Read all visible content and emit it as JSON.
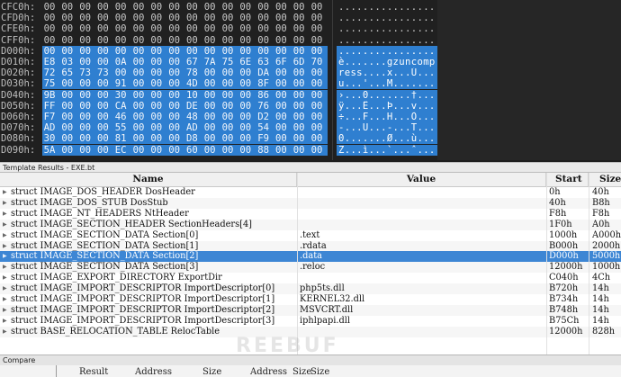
{
  "hex": {
    "rows": [
      {
        "addr": "CFC0h:",
        "bytes": [
          "00",
          "00",
          "00",
          "00",
          "00",
          "00",
          "00",
          "00",
          "00",
          "00",
          "00",
          "00",
          "00",
          "00",
          "00",
          "00"
        ],
        "ascii": "................",
        "selected": false
      },
      {
        "addr": "CFD0h:",
        "bytes": [
          "00",
          "00",
          "00",
          "00",
          "00",
          "00",
          "00",
          "00",
          "00",
          "00",
          "00",
          "00",
          "00",
          "00",
          "00",
          "00"
        ],
        "ascii": "................",
        "selected": false
      },
      {
        "addr": "CFE0h:",
        "bytes": [
          "00",
          "00",
          "00",
          "00",
          "00",
          "00",
          "00",
          "00",
          "00",
          "00",
          "00",
          "00",
          "00",
          "00",
          "00",
          "00"
        ],
        "ascii": "................",
        "selected": false
      },
      {
        "addr": "CFF0h:",
        "bytes": [
          "00",
          "00",
          "00",
          "00",
          "00",
          "00",
          "00",
          "00",
          "00",
          "00",
          "00",
          "00",
          "00",
          "00",
          "00",
          "00"
        ],
        "ascii": "................",
        "selected": false
      },
      {
        "addr": "D000h:",
        "bytes": [
          "00",
          "00",
          "00",
          "00",
          "00",
          "00",
          "00",
          "00",
          "00",
          "00",
          "00",
          "00",
          "00",
          "00",
          "00",
          "00"
        ],
        "ascii": "................",
        "selected": true
      },
      {
        "addr": "D010h:",
        "bytes": [
          "E8",
          "03",
          "00",
          "00",
          "0A",
          "00",
          "00",
          "00",
          "67",
          "7A",
          "75",
          "6E",
          "63",
          "6F",
          "6D",
          "70"
        ],
        "ascii": "è.......gzuncomp",
        "selected": true
      },
      {
        "addr": "D020h:",
        "bytes": [
          "72",
          "65",
          "73",
          "73",
          "00",
          "00",
          "00",
          "00",
          "78",
          "00",
          "00",
          "00",
          "DA",
          "00",
          "00",
          "00"
        ],
        "ascii": "ress....x...Ú...",
        "selected": true
      },
      {
        "addr": "D030h:",
        "bytes": [
          "75",
          "00",
          "00",
          "00",
          "91",
          "00",
          "00",
          "00",
          "4D",
          "00",
          "00",
          "00",
          "8F",
          "00",
          "00",
          "00"
        ],
        "ascii": "u...'...M.......",
        "selected": true
      },
      {
        "addr": "D040h:",
        "bytes": [
          "9B",
          "00",
          "00",
          "00",
          "30",
          "00",
          "00",
          "00",
          "10",
          "00",
          "00",
          "00",
          "86",
          "00",
          "00",
          "00"
        ],
        "ascii": "›...0.......†...",
        "selected": true
      },
      {
        "addr": "D050h:",
        "bytes": [
          "FF",
          "00",
          "00",
          "00",
          "CA",
          "00",
          "00",
          "00",
          "DE",
          "00",
          "00",
          "00",
          "76",
          "00",
          "00",
          "00"
        ],
        "ascii": "ÿ...Ê...Þ...v...",
        "selected": true
      },
      {
        "addr": "D060h:",
        "bytes": [
          "F7",
          "00",
          "00",
          "00",
          "46",
          "00",
          "00",
          "00",
          "48",
          "00",
          "00",
          "00",
          "D2",
          "00",
          "00",
          "00"
        ],
        "ascii": "÷...F...H...Ò...",
        "selected": true
      },
      {
        "addr": "D070h:",
        "bytes": [
          "AD",
          "00",
          "00",
          "00",
          "55",
          "00",
          "00",
          "00",
          "AD",
          "00",
          "00",
          "00",
          "54",
          "00",
          "00",
          "00"
        ],
        "ascii": "-...U...-...T...",
        "selected": true
      },
      {
        "addr": "D080h:",
        "bytes": [
          "30",
          "00",
          "00",
          "00",
          "81",
          "00",
          "00",
          "00",
          "D8",
          "00",
          "00",
          "00",
          "F9",
          "00",
          "00",
          "00"
        ],
        "ascii": "0.......Ø...ù...",
        "selected": true
      },
      {
        "addr": "D090h:",
        "bytes": [
          "5A",
          "00",
          "00",
          "00",
          "EC",
          "00",
          "00",
          "00",
          "60",
          "00",
          "00",
          "00",
          "88",
          "00",
          "00",
          "00"
        ],
        "ascii": "Z...ì...`...ˆ...",
        "selected": true
      }
    ]
  },
  "template": {
    "title": "Template Results - EXE.bt",
    "columns": {
      "name": "Name",
      "value": "Value",
      "start": "Start",
      "size": "Size"
    },
    "rows": [
      {
        "name": "struct IMAGE_DOS_HEADER DosHeader",
        "value": "",
        "start": "0h",
        "size": "40h",
        "selected": false
      },
      {
        "name": "struct IMAGE_DOS_STUB DosStub",
        "value": "",
        "start": "40h",
        "size": "B8h",
        "selected": false
      },
      {
        "name": "struct IMAGE_NT_HEADERS NtHeader",
        "value": "",
        "start": "F8h",
        "size": "F8h",
        "selected": false
      },
      {
        "name": "struct IMAGE_SECTION_HEADER SectionHeaders[4]",
        "value": "",
        "start": "1F0h",
        "size": "A0h",
        "selected": false
      },
      {
        "name": "struct IMAGE_SECTION_DATA Section[0]",
        "value": ".text",
        "start": "1000h",
        "size": "A000h",
        "selected": false
      },
      {
        "name": "struct IMAGE_SECTION_DATA Section[1]",
        "value": ".rdata",
        "start": "B000h",
        "size": "2000h",
        "selected": false
      },
      {
        "name": "struct IMAGE_SECTION_DATA Section[2]",
        "value": ".data",
        "start": "D000h",
        "size": "5000h",
        "selected": true
      },
      {
        "name": "struct IMAGE_SECTION_DATA Section[3]",
        "value": ".reloc",
        "start": "12000h",
        "size": "1000h",
        "selected": false
      },
      {
        "name": "struct IMAGE_EXPORT_DIRECTORY ExportDir",
        "value": "",
        "start": "C040h",
        "size": "4Ch",
        "selected": false
      },
      {
        "name": "struct IMAGE_IMPORT_DESCRIPTOR ImportDescriptor[0]",
        "value": "php5ts.dll",
        "start": "B720h",
        "size": "14h",
        "selected": false
      },
      {
        "name": "struct IMAGE_IMPORT_DESCRIPTOR ImportDescriptor[1]",
        "value": "KERNEL32.dll",
        "start": "B734h",
        "size": "14h",
        "selected": false
      },
      {
        "name": "struct IMAGE_IMPORT_DESCRIPTOR ImportDescriptor[2]",
        "value": "MSVCRT.dll",
        "start": "B748h",
        "size": "14h",
        "selected": false
      },
      {
        "name": "struct IMAGE_IMPORT_DESCRIPTOR ImportDescriptor[3]",
        "value": "iphlpapi.dll",
        "start": "B75Ch",
        "size": "14h",
        "selected": false
      },
      {
        "name": "struct BASE_RELOCATION_TABLE RelocTable",
        "value": "",
        "start": "12000h",
        "size": "828h",
        "selected": false
      }
    ]
  },
  "compare": {
    "title": "Compare",
    "columns": [
      "Result",
      "Address",
      "Size",
      "Address",
      "Size",
      "Size"
    ]
  },
  "watermark": "REEBUF",
  "colors": {
    "selection": "#2f7fd0",
    "row_selection": "#3d86d4",
    "hex_bg": "#202020"
  }
}
